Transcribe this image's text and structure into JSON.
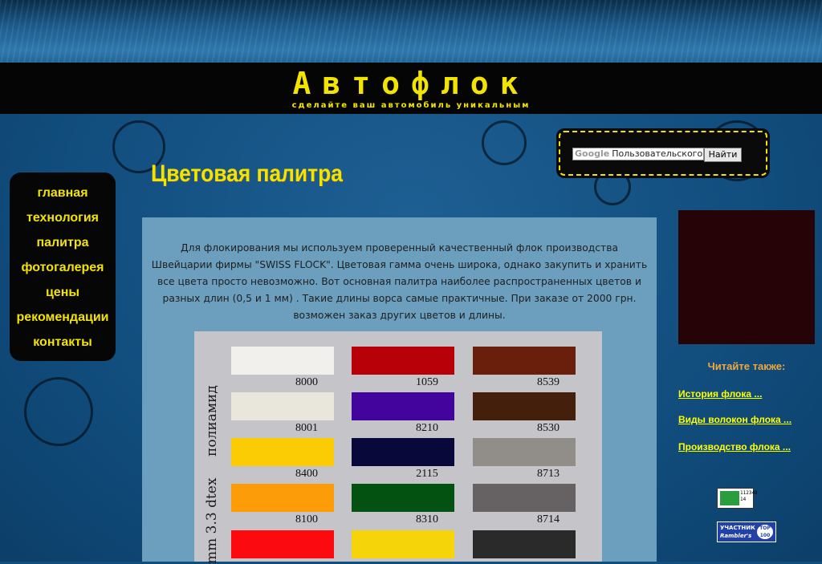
{
  "header": {
    "site_title": "Автофлок",
    "tagline": "сделайте ваш автомобиль уникальным"
  },
  "search": {
    "brand": "Google",
    "placeholder": "Пользовательского по",
    "button_label": "Найти"
  },
  "nav": {
    "items": [
      {
        "label": "главная"
      },
      {
        "label": "технология"
      },
      {
        "label": "палитра"
      },
      {
        "label": "фотогалерея"
      },
      {
        "label": "цены"
      },
      {
        "label": "рекомендации"
      },
      {
        "label": "контакты"
      }
    ]
  },
  "main": {
    "page_title": "Цветовая палитра",
    "intro": "Для флокирования мы используем проверенный качественный флок производства Швейцарии фирмы \"SWISS FLOCK\". Цветовая гамма очень широка, однако закупить и хранить все цвета просто невозможно. Вот основная палитра наиболее распространенных цветов и разных длин (0,5 и 1 мм) . Такие длины ворса самые практичные. При заказе от 2000 грн. возможен заказ других цветов и длины."
  },
  "palette": {
    "side_label_top": "полиамид",
    "side_label_bottom": "mm 3.3 dtex",
    "swatches": [
      {
        "code": "8000",
        "color": "#f2f0ec"
      },
      {
        "code": "1059",
        "color": "#b70008"
      },
      {
        "code": "8539",
        "color": "#6a1e0c"
      },
      {
        "code": "8001",
        "color": "#e9e6dc"
      },
      {
        "code": "8210",
        "color": "#43049e"
      },
      {
        "code": "8530",
        "color": "#44200c"
      },
      {
        "code": "8400",
        "color": "#fbcc03"
      },
      {
        "code": "2115",
        "color": "#08083a"
      },
      {
        "code": "8713",
        "color": "#918d88"
      },
      {
        "code": "8100",
        "color": "#fb9c08"
      },
      {
        "code": "8310",
        "color": "#035211"
      },
      {
        "code": "8714",
        "color": "#666264"
      },
      {
        "code": "",
        "color": "#fb0a10"
      },
      {
        "code": "",
        "color": "#f5d40a"
      },
      {
        "code": "",
        "color": "#2a2a2a"
      }
    ]
  },
  "sidebar": {
    "also_title": "Читайте также:",
    "links": [
      {
        "label": "История флока ..."
      },
      {
        "label": "Виды волокон флока ..."
      },
      {
        "label": "Производство флока ..."
      }
    ]
  },
  "counters": {
    "counter_value_1": "112348",
    "counter_value_2": "14",
    "rambler_line1": "УЧАСТНИК",
    "rambler_line2": "Rambler's",
    "rambler_top": "TOP 100"
  },
  "colors": {
    "accent_yellow": "#f3e400",
    "header_black": "#050505",
    "content_bg": "#6c9fbd",
    "background_blue": "#114d7d",
    "read_also_orange": "#f0a83c"
  }
}
